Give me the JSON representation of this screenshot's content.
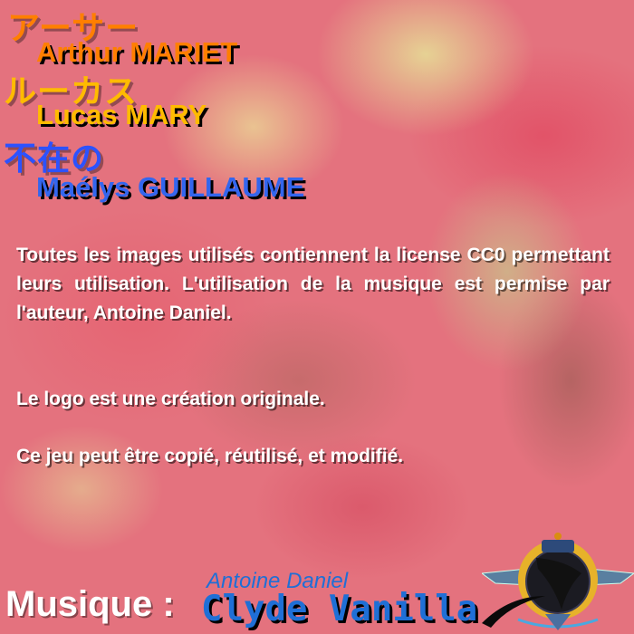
{
  "credits": [
    {
      "japanese": "アーサー",
      "name": "Arthur MARIET",
      "color": "#ff7f00"
    },
    {
      "japanese": "ルーカス",
      "name": "Lucas MARY",
      "color": "#ffbb00"
    },
    {
      "japanese": "不在の",
      "name": "Maélys GUILLAUME",
      "color": "#2c52ff"
    }
  ],
  "paragraphs": [
    "Toutes les images utilisés contiennent la license CC0 permettant leurs utilisation. L'utilisation de la musique est permise par l'auteur, Antoine Daniel.",
    "Le logo est une création originale.",
    "Ce jeu peut être copié, réutilisé, et modifié."
  ],
  "music": {
    "label": "Musique :",
    "artist": "Antoine Daniel",
    "title": "Clyde Vanilla"
  },
  "logo": {
    "icon": "winged-emblem-logo"
  }
}
